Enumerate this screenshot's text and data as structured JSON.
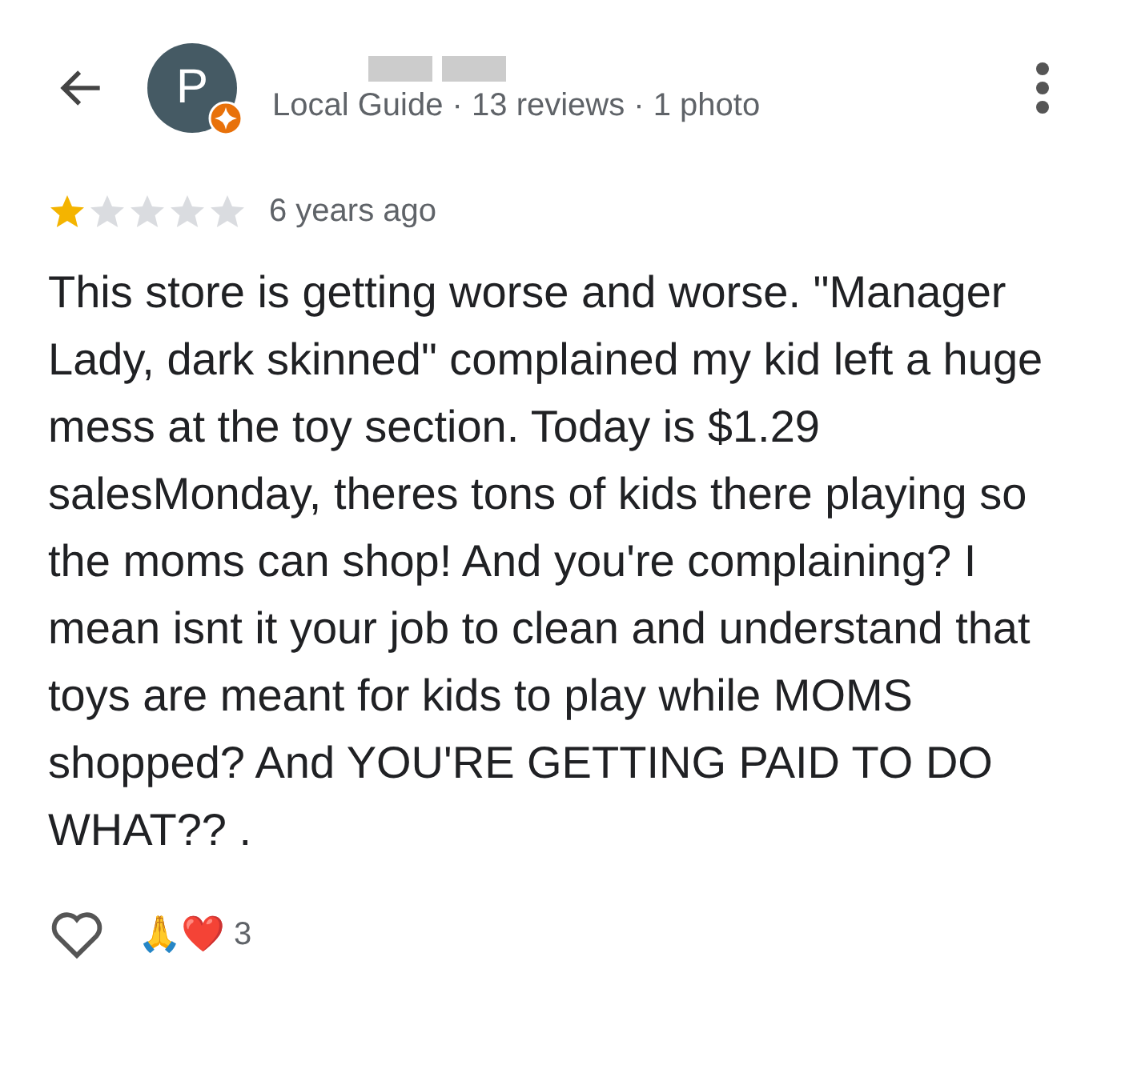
{
  "reviewer": {
    "avatar_letter": "P",
    "local_guide": true,
    "details": "Local Guide · 13 reviews · 1 photo"
  },
  "review": {
    "stars": 1,
    "time": "6 years ago",
    "text": "This store is getting worse and worse. \"Manager Lady, dark skinned\" complained my kid left a huge mess at the toy section. Today is $1.29 salesMonday, theres tons of kids there playing so the moms can shop! And you're complaining? I mean isnt it your job to clean and understand that toys are meant for kids to play while MOMS shopped? And YOU'RE GETTING PAID TO DO WHAT?? ."
  },
  "reactions": {
    "liked": false,
    "emoji": "🙏❤️",
    "count": "3"
  }
}
